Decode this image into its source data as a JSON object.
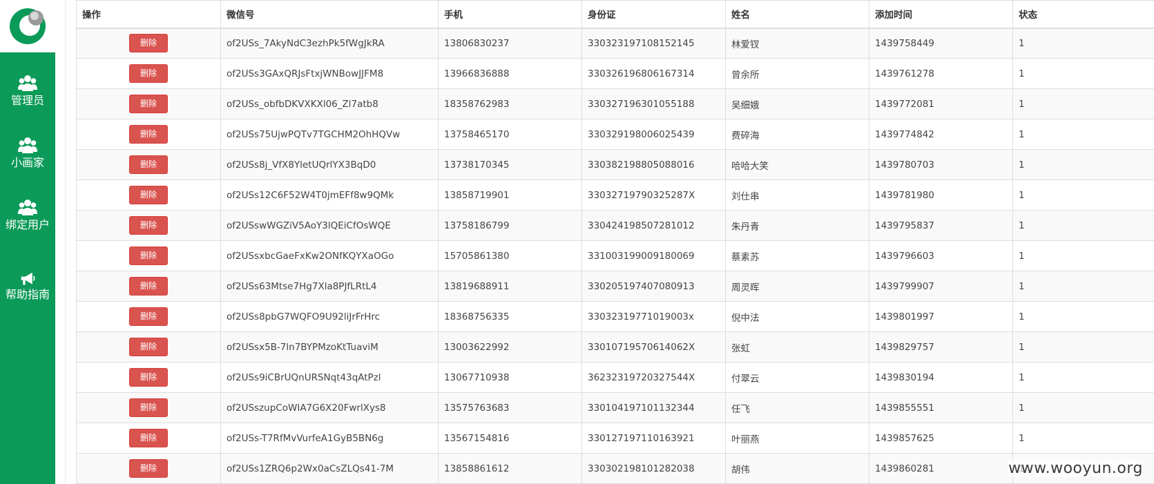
{
  "sidebar": {
    "items": [
      {
        "label": "管理员",
        "icon": "users-icon"
      },
      {
        "label": "小画家",
        "icon": "users-icon"
      },
      {
        "label": "绑定用户",
        "icon": "users-icon"
      },
      {
        "label": "帮助指南",
        "icon": "megaphone-icon"
      }
    ]
  },
  "colors": {
    "sidebar_bg": "#0b9a58",
    "delete_button": "#d9534f",
    "row_stripe": "#f9f9f9"
  },
  "table": {
    "headers": [
      "操作",
      "微信号",
      "手机",
      "身份证",
      "姓名",
      "添加时间",
      "状态"
    ],
    "delete_label": "删除",
    "rows": [
      [
        "of2USs_7AkyNdC3ezhPk5fWgJkRA",
        "13806830237",
        "330323197108152145",
        "林爱钗",
        "1439758449",
        "1"
      ],
      [
        "of2USs3GAxQRJsFtxjWNBowJJFM8",
        "13966836888",
        "330326196806167314",
        "曾余所",
        "1439761278",
        "1"
      ],
      [
        "of2USs_obfbDKVXKXl06_Zl7atb8",
        "18358762983",
        "330327196301055188",
        "吴细娥",
        "1439772081",
        "1"
      ],
      [
        "of2USs75UjwPQTv7TGCHM2OhHQVw",
        "13758465170",
        "330329198006025439",
        "费碎海",
        "1439774842",
        "1"
      ],
      [
        "of2USs8j_VfX8YletUQrlYX3BqD0",
        "13738170345",
        "330382198805088016",
        "哈哈大笑",
        "1439780703",
        "1"
      ],
      [
        "of2USs12C6F52W4T0jmEFf8w9QMk",
        "13858719901",
        "33032719790325287X",
        "刘仕串",
        "1439781980",
        "1"
      ],
      [
        "of2USswWGZiV5AoY3lQEiCfOsWQE",
        "13758186799",
        "330424198507281012",
        "朱丹青",
        "1439795837",
        "1"
      ],
      [
        "of2USsxbcGaeFxKw2ONfKQYXaOGo",
        "15705861380",
        "331003199009180069",
        "蔡素苏",
        "1439796603",
        "1"
      ],
      [
        "of2USs63Mtse7Hg7Xla8PJfLRtL4",
        "13819688911",
        "330205197407080913",
        "周灵晖",
        "1439799907",
        "1"
      ],
      [
        "of2USs8pbG7WQFO9U92liJrFrHrc",
        "18368756335",
        "33032319771019003x",
        "倪中法",
        "1439801997",
        "1"
      ],
      [
        "of2USsx5B-7ln7BYPMzoKtTuaviM",
        "13003622992",
        "33010719570614062X",
        "张虹",
        "1439829757",
        "1"
      ],
      [
        "of2USs9iCBrUQnURSNqt43qAtPzl",
        "13067710938",
        "36232319720327544X",
        "付翠云",
        "1439830194",
        "1"
      ],
      [
        "of2USszupCoWIA7G6X20FwrlXys8",
        "13575763683",
        "330104197101132344",
        "任飞",
        "1439855551",
        "1"
      ],
      [
        "of2USs-T7RfMvVurfeA1GyB5BN6g",
        "13567154816",
        "330127197110163921",
        "叶丽燕",
        "1439857625",
        "1"
      ],
      [
        "of2USs1ZRQ6p2Wx0aCsZLQs41-7M",
        "13858861612",
        "330302198101282038",
        "胡伟",
        "1439860281",
        "1"
      ]
    ]
  },
  "watermark": "www.wooyun.org"
}
